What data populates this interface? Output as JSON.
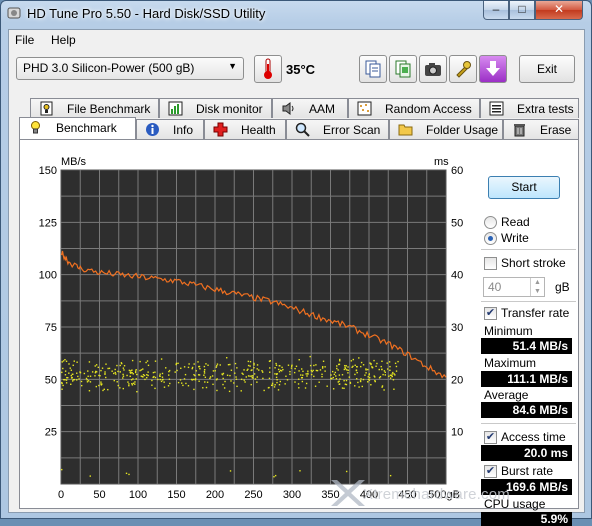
{
  "window": {
    "title": "HD Tune Pro 5.50 - Hard Disk/SSD Utility",
    "minimize_glyph": "–",
    "maximize_glyph": "□",
    "close_glyph": "✕"
  },
  "menu": {
    "file": "File",
    "help": "Help"
  },
  "toolbar": {
    "drive": "PHD 3.0 Silicon-Power (500 gB)",
    "temperature": "35°C",
    "exit_label": "Exit",
    "icons": [
      "copy-info-icon",
      "copy-screen-icon",
      "screenshot-camera-icon",
      "options-tools-icon",
      "save-download-icon"
    ]
  },
  "tabs_top": [
    {
      "label": "File Benchmark",
      "icon": "file-benchmark-icon"
    },
    {
      "label": "Disk monitor",
      "icon": "disk-monitor-icon"
    },
    {
      "label": "AAM",
      "icon": "speaker-icon"
    },
    {
      "label": "Random Access",
      "icon": "random-access-icon"
    },
    {
      "label": "Extra tests",
      "icon": "extra-tests-icon"
    }
  ],
  "tabs_bottom": [
    {
      "label": "Benchmark",
      "icon": "lightbulb-icon"
    },
    {
      "label": "Info",
      "icon": "info-icon"
    },
    {
      "label": "Health",
      "icon": "health-cross-icon"
    },
    {
      "label": "Error Scan",
      "icon": "magnifier-icon"
    },
    {
      "label": "Folder Usage",
      "icon": "folder-icon"
    },
    {
      "label": "Erase",
      "icon": "trash-icon"
    }
  ],
  "controls": {
    "start_label": "Start",
    "read_label": "Read",
    "write_label": "Write",
    "mode_selected": "Write",
    "short_stroke_label": "Short stroke",
    "short_stroke_checked": false,
    "short_stroke_value": "40",
    "short_stroke_unit": "gB",
    "transfer_rate_label": "Transfer rate",
    "transfer_rate_checked": true,
    "minimum_label": "Minimum",
    "minimum_value": "51.4 MB/s",
    "maximum_label": "Maximum",
    "maximum_value": "111.1 MB/s",
    "average_label": "Average",
    "average_value": "84.6 MB/s",
    "access_time_label": "Access time",
    "access_time_checked": true,
    "access_time_value": "20.0 ms",
    "burst_rate_label": "Burst rate",
    "burst_rate_checked": true,
    "burst_rate_value": "169.6 MB/s",
    "cpu_usage_label": "CPU usage",
    "cpu_usage_value": "5.9%"
  },
  "watermark": "Xtremehardware.com",
  "colors": {
    "plot_bg": "#2e2e2e",
    "grid": "#7a7a7a",
    "transfer_line": "#f07020",
    "access_points": "#e6e620"
  },
  "chart_data": {
    "type": "line",
    "left_axis_label": "MB/s",
    "right_axis_label": "ms",
    "x_unit": "gB",
    "x_ticks": [
      "0",
      "50",
      "100",
      "150",
      "200",
      "250",
      "300",
      "350",
      "400",
      "450",
      "500gB"
    ],
    "y_left_ticks": [
      "150",
      "125",
      "100",
      "75",
      "50",
      "25"
    ],
    "y_right_ticks": [
      "60",
      "50",
      "40",
      "30",
      "20",
      "10"
    ],
    "xlim": [
      0,
      500
    ],
    "ylim_left": [
      0,
      150
    ],
    "ylim_right": [
      0,
      60
    ],
    "grid": true,
    "series": [
      {
        "name": "Transfer rate",
        "axis": "left",
        "x": [
          0,
          10,
          25,
          50,
          75,
          100,
          125,
          150,
          175,
          200,
          225,
          250,
          275,
          300,
          325,
          350,
          375,
          400,
          425,
          450,
          475,
          500
        ],
        "y": [
          111,
          106,
          103,
          101,
          100,
          99,
          98,
          97,
          95,
          93,
          91,
          89,
          87,
          84,
          81,
          78,
          75,
          71,
          67,
          62,
          56,
          51
        ]
      },
      {
        "name": "Access time",
        "axis": "right",
        "type": "scatter",
        "band_center_ms": 21,
        "band_spread_ms": 3.5,
        "outlier_low_ms": 1.5
      }
    ]
  }
}
